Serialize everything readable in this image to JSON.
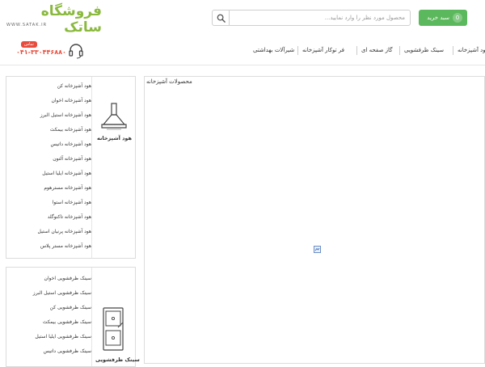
{
  "header": {
    "logo_text": "فروشگاه ساتک",
    "logo_url": "WWW.SATAK.IR",
    "cart_label": "سبد خرید",
    "cart_count": "0",
    "search_placeholder": "محصول مورد نظر را وارد نمایید...",
    "phone_badge": "تماس",
    "phone_number": "۰۴۱-۳۳۰۴۴۶۸۸۰",
    "accent_color": "#5cb85c",
    "brand_color": "#8ab93e",
    "phone_color": "#e74c3c"
  },
  "nav": {
    "items": [
      {
        "label": "هود آشپزخانه"
      },
      {
        "label": "سینک ظرفشویی"
      },
      {
        "label": "گاز صفحه ای"
      },
      {
        "label": "فر توکار آشپزخانه"
      },
      {
        "label": "شیرآلات بهداشتی"
      }
    ]
  },
  "panels": [
    {
      "title": "هود آشپزخانه",
      "icon": "range-hood-icon",
      "items": [
        "هود آشپزخانه کن",
        "هود آشپزخانه اخوان",
        "هود آشپزخانه استیل البرز",
        "هود آشپزخانه بیمکث",
        "هود آشپزخانه داتیس",
        "هود آشپزخانه آلتون",
        "هود آشپزخانه ایلیا استیل",
        "هود آشپزخانه مسترهوم",
        "هود آشپزخانه استوا",
        "هود آشپزخانه تاکنوگلد",
        "هود آشپزخانه پرنیان استیل",
        "هود آشپزخانه مستر پلاس"
      ]
    },
    {
      "title": "سینک ظرفشویی",
      "icon": "sink-icon",
      "items": [
        "سینک ظرفشویی اخوان",
        "سینک ظرفشویی استیل البرز",
        "سینک ظرفشویی کن",
        "سینک ظرفشویی بیمکث",
        "سینک ظرفشویی ایلیا استیل",
        "سینک ظرفشویی داتیس"
      ]
    }
  ],
  "main": {
    "heading": "محصولات آشپزخانه"
  }
}
